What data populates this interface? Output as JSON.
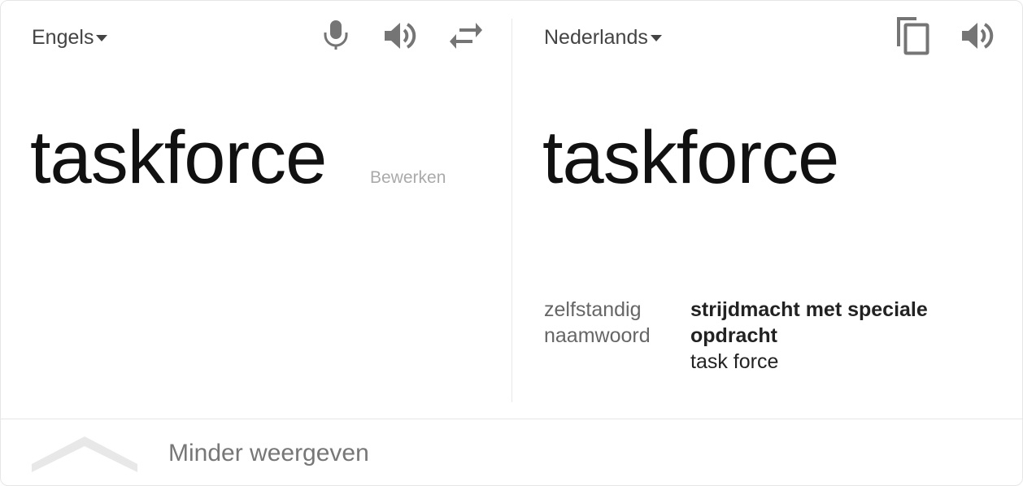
{
  "source": {
    "language": "Engels",
    "text": "taskforce",
    "edit_label": "Bewerken",
    "icons": {
      "microphone": "microphone-icon",
      "speaker": "speaker-icon",
      "swap": "swap-arrows-icon"
    }
  },
  "target": {
    "language": "Nederlands",
    "text": "taskforce",
    "icons": {
      "copy": "copy-icon",
      "speaker": "speaker-icon"
    }
  },
  "dictionary": {
    "part_of_speech_line1": "zelfstandig",
    "part_of_speech_line2": "naamwoord",
    "definition_line1": "strijdmacht met speciale",
    "definition_line2": "opdracht",
    "synonym": "task force"
  },
  "footer": {
    "toggle_label": "Minder weergeven",
    "toggle_icon": "chevron-up-icon"
  },
  "colors": {
    "icon_gray": "#757575",
    "text_dark": "#222222",
    "text_muted": "#666666",
    "edit_link": "#aaaaaa",
    "chevron": "#e8e8e8"
  }
}
